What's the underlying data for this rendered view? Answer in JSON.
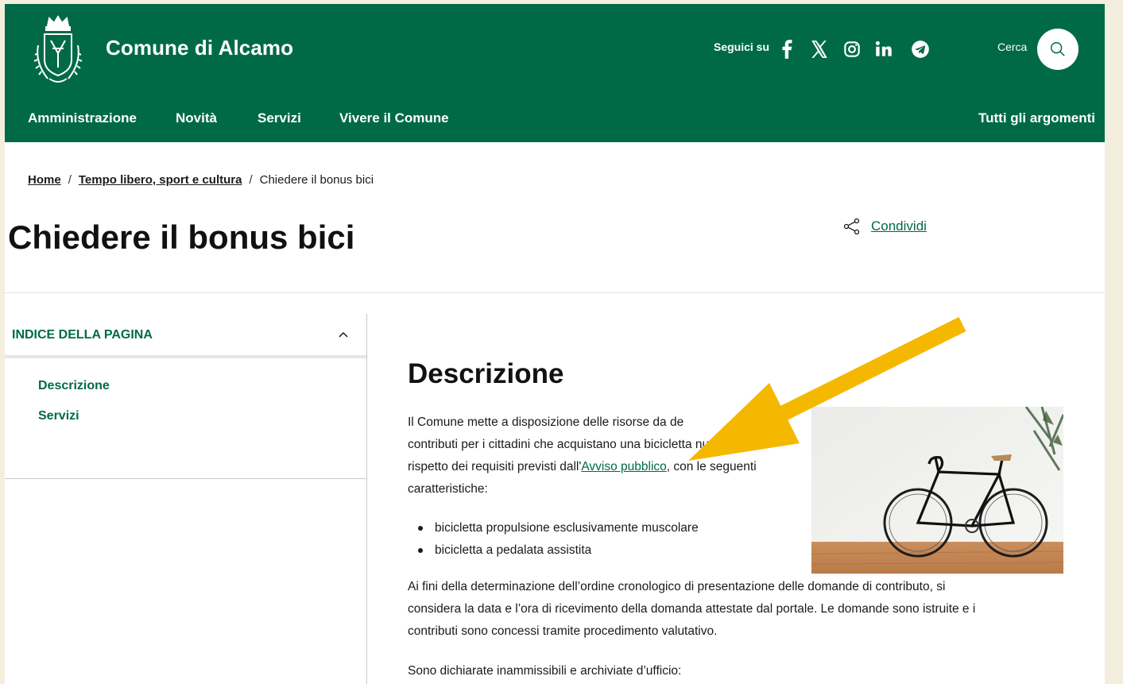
{
  "header": {
    "site_title": "Comune di Alcamo",
    "follow_label": "Seguici su",
    "social": [
      "facebook-icon",
      "x-icon",
      "instagram-icon",
      "linkedin-icon",
      "telegram-icon"
    ],
    "search_label": "Cerca",
    "brand_color": "#006a46"
  },
  "nav": {
    "items": [
      "Amministrazione",
      "Novità",
      "Servizi",
      "Vivere il Comune"
    ],
    "topics": "Tutti gli argomenti"
  },
  "breadcrumb": {
    "items": [
      "Home",
      "Tempo libero, sport e cultura"
    ],
    "current": "Chiedere il bonus bici",
    "separator": "/"
  },
  "page": {
    "title": "Chiedere il bonus bici",
    "share_label": "Condividi"
  },
  "toc": {
    "title": "INDICE DELLA PAGINA",
    "items": [
      "Descrizione",
      "Servizi"
    ]
  },
  "content": {
    "section_title": "Descrizione",
    "intro_lines": [
      "Il Comune mette a disposizione delle risorse da de",
      "contributi per i cittadini che acquistano una bicicletta nuova, nel"
    ],
    "intro_line3_before": "rispetto dei requisiti previsti dall'",
    "intro_link": "Avviso pubblico",
    "intro_line3_after": ", con le seguenti",
    "intro_line4": "caratteristiche:",
    "bullets": [
      "bicicletta propulsione esclusivamente muscolare",
      "bicicletta a pedalata assistita"
    ],
    "para2_lines": [
      "Ai fini della determinazione dell’ordine cronologico di presentazione delle domande di contributo, si",
      "considera la data e l’ora di ricevimento della domanda attestate dal portale. Le domande sono istruite e i",
      "contributi sono concessi tramite procedimento valutativo."
    ],
    "para3": "Sono dichiarate inammissibili e archiviate d’ufficio:"
  },
  "annotation": {
    "arrow_color": "#f5b800"
  }
}
